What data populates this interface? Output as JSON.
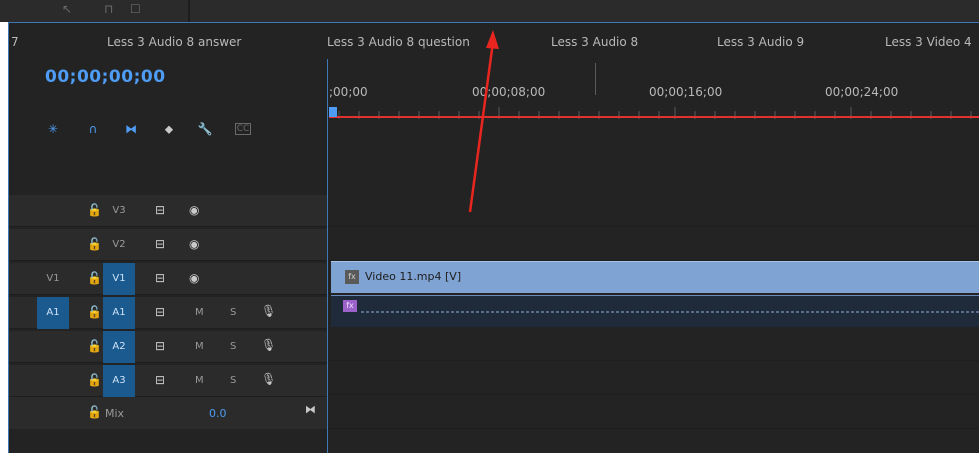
{
  "sequence_tabs": [
    {
      "label": "7"
    },
    {
      "label": "Less 3 Audio 8 answer"
    },
    {
      "label": "Less 3 Audio 8 question"
    },
    {
      "label": "Less 3 Audio 8"
    },
    {
      "label": "Less 3 Audio 9"
    },
    {
      "label": "Less 3 Video 4"
    }
  ],
  "timecode": "00;00;00;00",
  "ruler_labels": [
    ";00;00",
    "00;00;08;00",
    "00;00;16;00",
    "00;00;24;00"
  ],
  "tracks": {
    "video": [
      {
        "target": "V3",
        "source": ""
      },
      {
        "target": "V2",
        "source": ""
      },
      {
        "target": "V1",
        "source": "V1"
      }
    ],
    "audio": [
      {
        "target": "A1",
        "source": "A1",
        "m": "M",
        "s": "S"
      },
      {
        "target": "A2",
        "source": "",
        "m": "M",
        "s": "S"
      },
      {
        "target": "A3",
        "source": "",
        "m": "M",
        "s": "S"
      }
    ],
    "mix_label": "Mix",
    "mix_value": "0.0"
  },
  "clips": {
    "video_clip_name": "Video 11.mp4 [V]",
    "fx_badge": "fx"
  },
  "colors": {
    "accent_blue": "#4e9cf4",
    "panel_bg": "#232323",
    "clip_video": "#7fa3d2",
    "work_bar": "#e03030",
    "arrow_red": "#e8261f"
  }
}
